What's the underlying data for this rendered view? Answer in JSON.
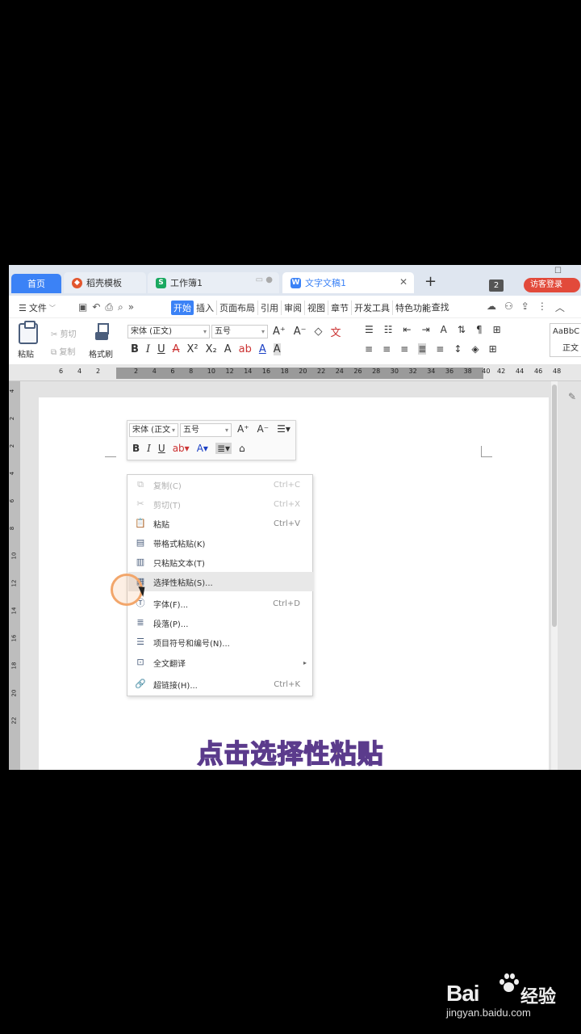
{
  "tabs": {
    "home": "首页",
    "templates": "稻壳模板",
    "workbook": "工作簿1",
    "document": "文字文稿1",
    "new_tab": "+",
    "window_count": "2",
    "login": "访客登录"
  },
  "menu": {
    "file": "文件",
    "tabs": [
      "开始",
      "插入",
      "页面布局",
      "引用",
      "审阅",
      "视图",
      "章节",
      "开发工具",
      "特色功能"
    ],
    "active_tab": "开始",
    "search": "查找"
  },
  "ribbon": {
    "paste": "粘贴",
    "cut": "剪切",
    "copy": "复制",
    "format_painter": "格式刷",
    "font_name": "宋体 (正文)",
    "font_size": "五号",
    "style_sample": "AaBbC",
    "style_name": "正文"
  },
  "ruler": {
    "left_ticks": [
      "6",
      "4",
      "2"
    ],
    "ticks": [
      "2",
      "4",
      "6",
      "8",
      "10",
      "12",
      "14",
      "16",
      "18",
      "20",
      "22",
      "24",
      "26",
      "28",
      "30",
      "32",
      "34",
      "36",
      "38",
      "40"
    ],
    "right_ticks": [
      "42",
      "44",
      "46",
      "48"
    ],
    "vertical_ticks": [
      "4",
      "2",
      "2",
      "4",
      "6",
      "8",
      "10",
      "12",
      "14",
      "16",
      "18",
      "20",
      "22"
    ]
  },
  "mini_toolbar": {
    "font_name": "宋体 (正文",
    "font_size": "五号"
  },
  "context_menu": {
    "items": [
      {
        "label": "复制(C)",
        "shortcut": "Ctrl+C",
        "icon": "copy-icon",
        "disabled": true
      },
      {
        "label": "剪切(T)",
        "shortcut": "Ctrl+X",
        "icon": "cut-icon",
        "disabled": true
      },
      {
        "label": "粘贴",
        "shortcut": "Ctrl+V",
        "icon": "paste-icon",
        "disabled": false
      },
      {
        "label": "带格式粘贴(K)",
        "shortcut": "",
        "icon": "paste-format-icon",
        "disabled": false
      },
      {
        "label": "只粘贴文本(T)",
        "shortcut": "",
        "icon": "paste-text-icon",
        "disabled": false
      },
      {
        "label": "选择性粘贴(S)...",
        "shortcut": "",
        "icon": "paste-special-icon",
        "disabled": false
      },
      {
        "label": "字体(F)...",
        "shortcut": "Ctrl+D",
        "icon": "font-icon",
        "disabled": false
      },
      {
        "label": "段落(P)...",
        "shortcut": "",
        "icon": "paragraph-icon",
        "disabled": false
      },
      {
        "label": "项目符号和编号(N)...",
        "shortcut": "",
        "icon": "list-icon",
        "disabled": false
      },
      {
        "label": "全文翻译",
        "shortcut": "",
        "icon": "translate-icon",
        "disabled": false
      },
      {
        "label": "超链接(H)...",
        "shortcut": "Ctrl+K",
        "icon": "link-icon",
        "disabled": false
      }
    ],
    "hovered": "选择性粘贴(S)..."
  },
  "caption": "点击选择性粘贴",
  "watermark": {
    "brand": "Bai",
    "product": "经验",
    "url": "jingyan.baidu.com"
  },
  "colors": {
    "accent": "#3b82f6",
    "login": "#e24a3b",
    "click_ring": "#f2a66b",
    "caption_fill": "#f6e4b0",
    "caption_stroke": "#5b3b8c"
  }
}
